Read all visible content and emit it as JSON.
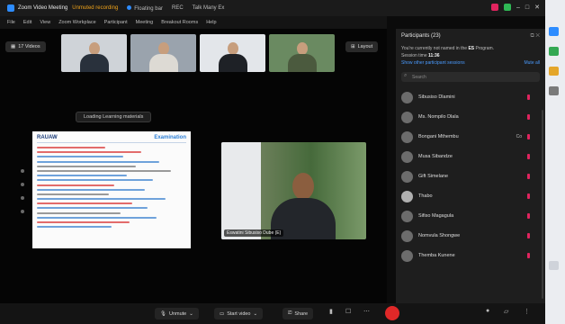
{
  "window": {
    "title": "Zoom Video Meeting",
    "warning": "Unmuted recording",
    "floating_dots": "Floating bar",
    "seg1": "REC",
    "seg2": "Talk Many Ex"
  },
  "menu": [
    "File",
    "Edit",
    "View",
    "Zoom Workplace",
    "Participant",
    "Meeting",
    "Breakout Rooms",
    "Help"
  ],
  "stage": {
    "gallery_label": "17 Videos",
    "layout_label": "Layout",
    "show_button": "Loading Learning materials",
    "thumb_count": 4,
    "slide": {
      "logo": "RAUAW",
      "title": "Examination",
      "line_colors": [
        "r",
        "r",
        "b",
        "b",
        "g",
        "g",
        "b",
        "b",
        "r",
        "b",
        "g",
        "b",
        "r",
        "b",
        "g",
        "b",
        "r",
        "b"
      ]
    },
    "speaker_name": "Eswatini Sibusiso Dube (E)"
  },
  "toolbar": {
    "unmute_label": "Unmute",
    "video_label": "Start video",
    "share_label": "Share"
  },
  "participants": {
    "header": "Participants (23)",
    "notice_line1": "You're currently not named in the",
    "notice_bold": "ES",
    "notice_line1_end": "Program.",
    "session": "Session time",
    "session_value": "11:36",
    "link": "Show other participant sessions",
    "link2": "Mute all",
    "search_placeholder": "Search",
    "people": [
      {
        "initial": "O",
        "name": "Sibusiso Dlamini"
      },
      {
        "initial": "O",
        "name": "Ms. Nompilo Dlala"
      },
      {
        "initial": "O",
        "name": "Bongani Mthembu",
        "flag": "Co"
      },
      {
        "initial": "O",
        "name": "Musa Sibandze"
      },
      {
        "initial": "O",
        "name": "Gift Simelane"
      },
      {
        "initial": "O",
        "name": "Thabo"
      },
      {
        "initial": "O",
        "name": "Sifiso Magagula"
      },
      {
        "initial": "O",
        "name": "Nomvula Shongwe"
      },
      {
        "initial": "O",
        "name": "Themba Kunene"
      }
    ]
  },
  "colors": {
    "leave": "#e02828",
    "accent": "#2d8cff",
    "mute_indicator": "#e0245e"
  }
}
